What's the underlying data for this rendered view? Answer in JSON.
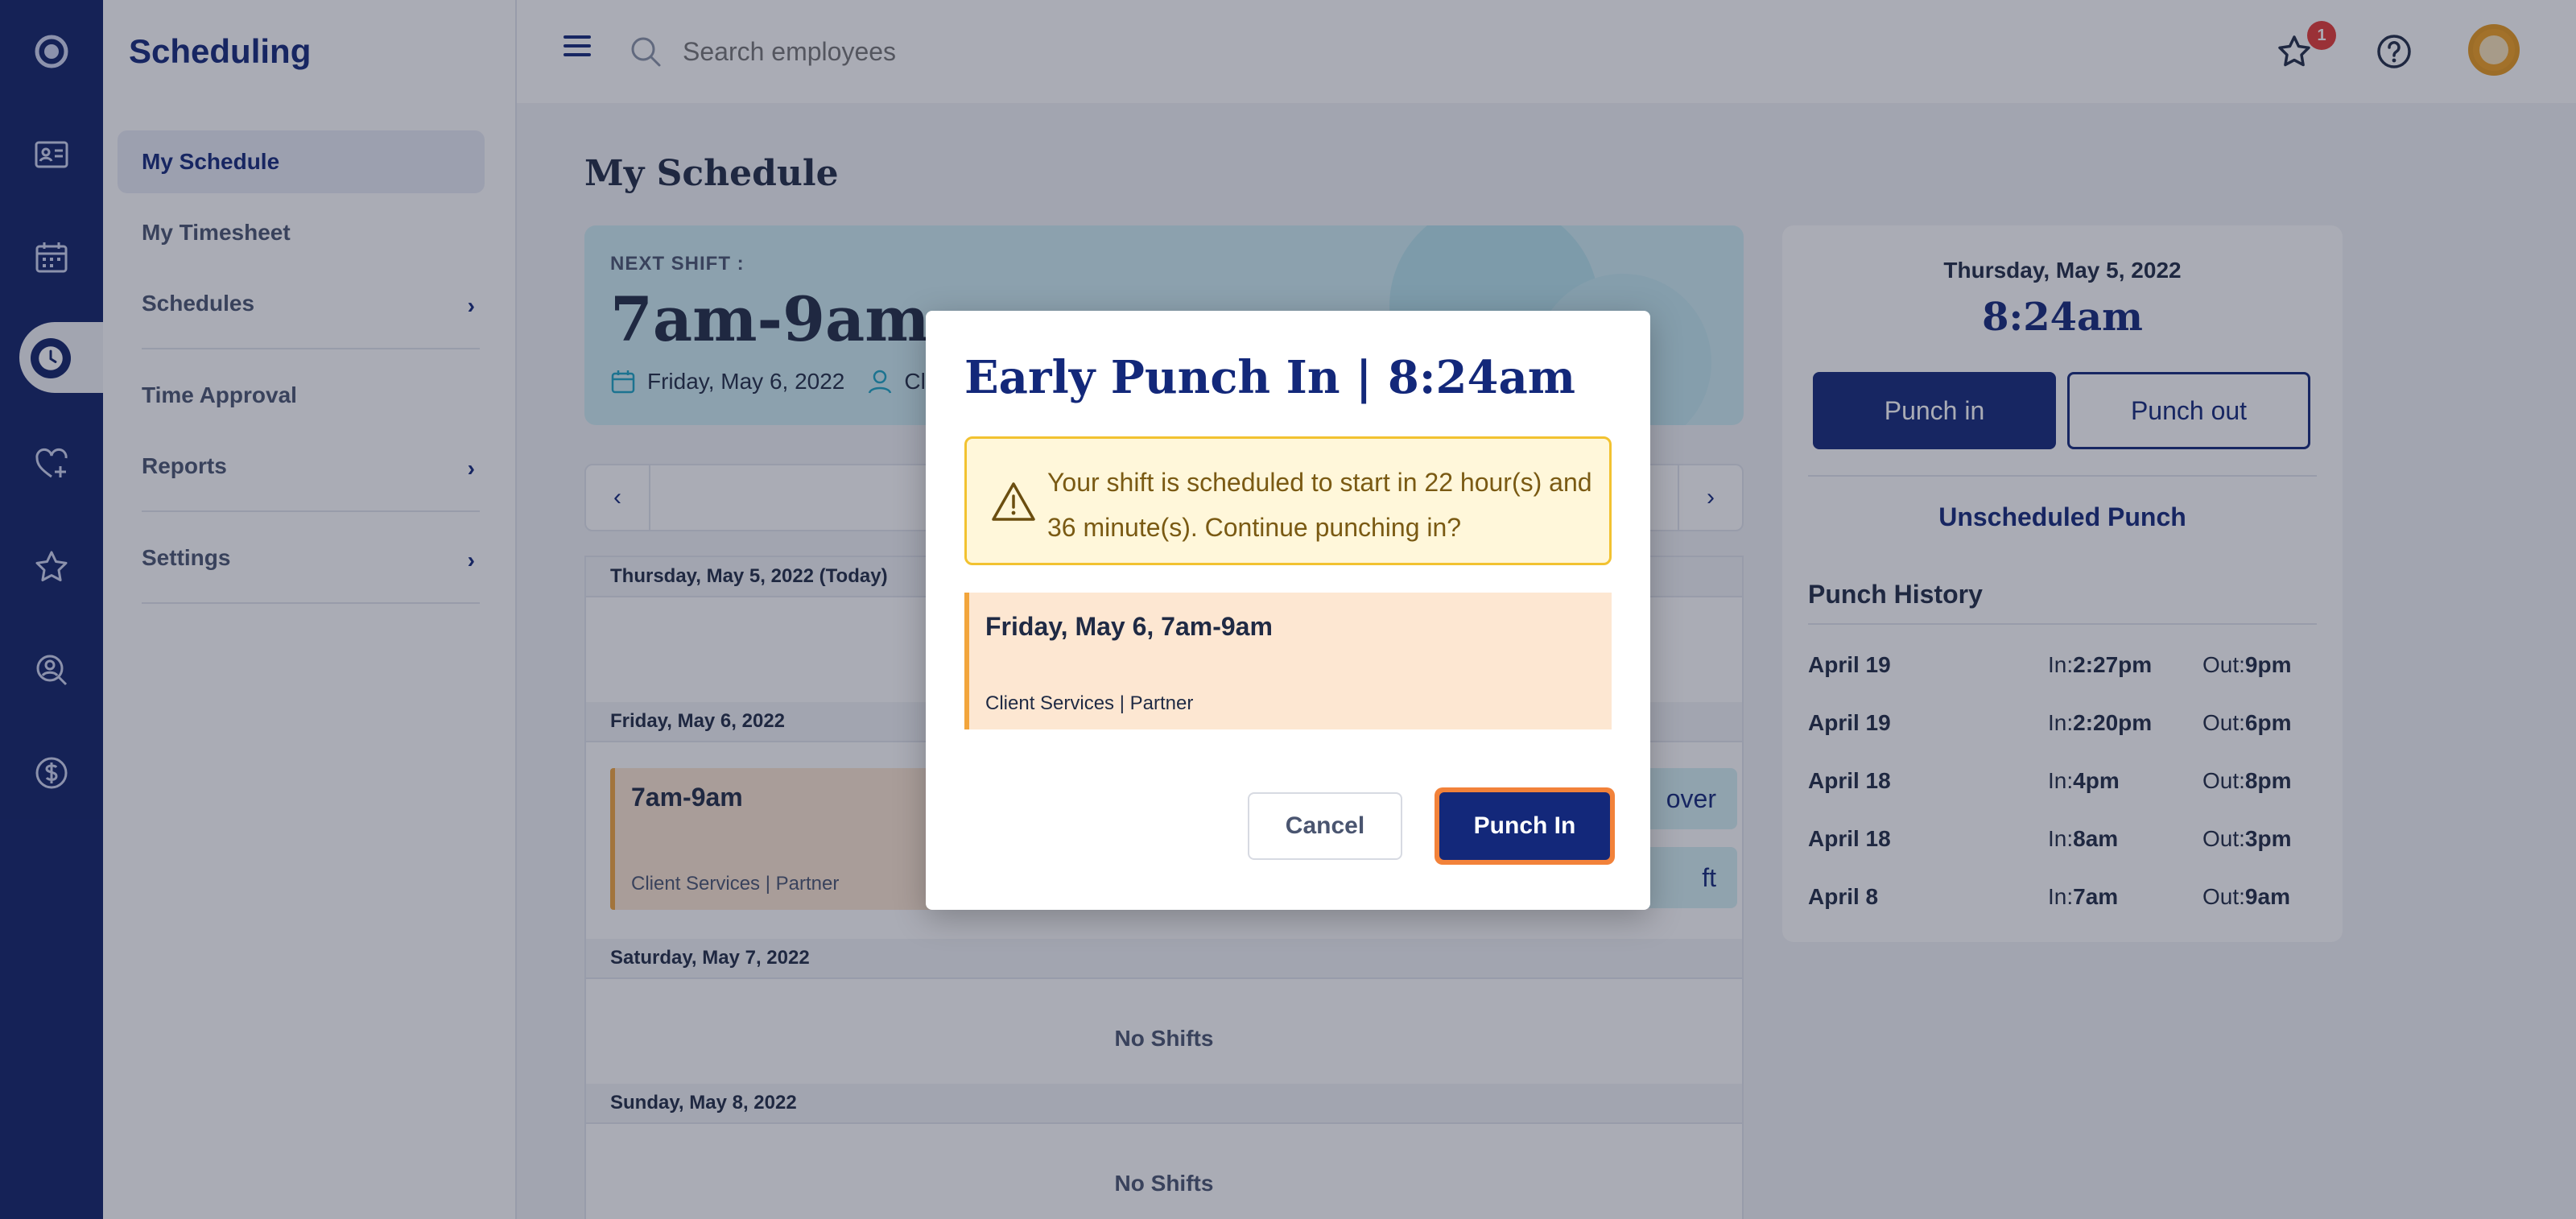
{
  "sidebar": {
    "title": "Scheduling",
    "items": [
      {
        "label": "My Schedule"
      },
      {
        "label": "My Timesheet"
      },
      {
        "label": "Schedules"
      },
      {
        "label": "Time Approval"
      },
      {
        "label": "Reports"
      },
      {
        "label": "Settings"
      }
    ]
  },
  "topbar": {
    "search_placeholder": "Search employees",
    "notification_count": "1"
  },
  "main": {
    "title": "My Schedule",
    "next_shift": {
      "label": "NEXT SHIFT :",
      "time": "7am-9am",
      "date": "Friday, May 6, 2022",
      "person_truncated": "Cli"
    },
    "days": [
      {
        "header": "Thursday, May 5, 2022 (Today)"
      },
      {
        "header": "Friday, May 6, 2022",
        "shift_time": "7am-9am",
        "shift_detail": "Client Services | Partner",
        "btn1": "over",
        "btn2": "ft"
      },
      {
        "header": "Saturday, May 7, 2022",
        "empty": "No Shifts"
      },
      {
        "header": "Sunday, May 8, 2022",
        "empty": "No Shifts"
      }
    ]
  },
  "punch_panel": {
    "date": "Thursday, May 5, 2022",
    "time": "8:24am",
    "punch_in": "Punch in",
    "punch_out": "Punch out",
    "unscheduled": "Unscheduled Punch",
    "history_title": "Punch History",
    "in_label": "In:",
    "out_label": "Out:",
    "history": [
      {
        "date": "April 19",
        "in": "2:27pm",
        "out": "9pm"
      },
      {
        "date": "April 19",
        "in": "2:20pm",
        "out": "6pm"
      },
      {
        "date": "April 18",
        "in": "4pm",
        "out": "8pm"
      },
      {
        "date": "April 18",
        "in": "8am",
        "out": "3pm"
      },
      {
        "date": "April 8",
        "in": "7am",
        "out": "9am"
      }
    ]
  },
  "modal": {
    "title": "Early Punch In | 8:24am",
    "warning": "Your shift is scheduled to start in 22 hour(s) and 36 minute(s). Continue punching in?",
    "shift_title": "Friday, May 6, 7am-9am",
    "shift_detail": "Client Services |  Partner",
    "cancel": "Cancel",
    "confirm": "Punch In"
  },
  "colors": {
    "brand": "#0f2167",
    "accent": "#f2823a",
    "warning_border": "#f2c230",
    "shift_accent": "#f2a53c"
  }
}
